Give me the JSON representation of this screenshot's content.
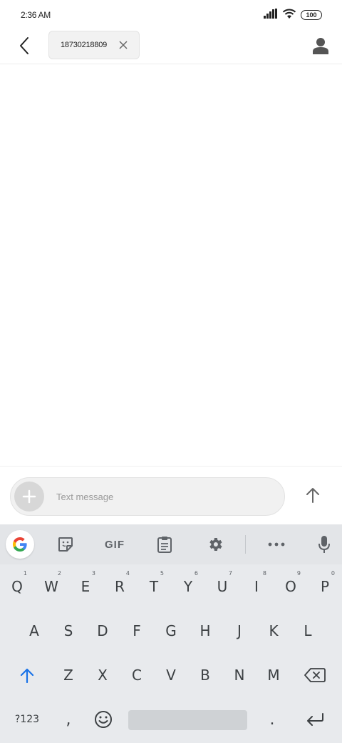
{
  "status_bar": {
    "time": "2:36 AM",
    "battery": "100",
    "icons": [
      "signal-icon",
      "wifi-icon",
      "battery-icon"
    ]
  },
  "header": {
    "recipient": "18730218809",
    "icons": [
      "back-arrow-icon",
      "close-icon",
      "person-icon"
    ]
  },
  "compose": {
    "placeholder": "Text message",
    "value": ""
  },
  "keyboard": {
    "toolbar": {
      "gif_label": "GIF",
      "icons": [
        "google-g-icon",
        "sticker-icon",
        "clipboard-icon",
        "gear-icon",
        "more-icon",
        "mic-icon"
      ]
    },
    "row1": [
      {
        "key": "Q",
        "hint": "1"
      },
      {
        "key": "W",
        "hint": "2"
      },
      {
        "key": "E",
        "hint": "3"
      },
      {
        "key": "R",
        "hint": "4"
      },
      {
        "key": "T",
        "hint": "5"
      },
      {
        "key": "Y",
        "hint": "6"
      },
      {
        "key": "U",
        "hint": "7"
      },
      {
        "key": "I",
        "hint": "8"
      },
      {
        "key": "O",
        "hint": "9"
      },
      {
        "key": "P",
        "hint": "0"
      }
    ],
    "row2": [
      "A",
      "S",
      "D",
      "F",
      "G",
      "H",
      "J",
      "K",
      "L"
    ],
    "row3": [
      "Z",
      "X",
      "C",
      "V",
      "B",
      "N",
      "M"
    ],
    "row4": {
      "symbols_label": "?123",
      "comma": ",",
      "period": "."
    },
    "colors": {
      "background": "#e8eaed",
      "shift_accent": "#1a73e8",
      "key_text": "#3c4043"
    }
  }
}
